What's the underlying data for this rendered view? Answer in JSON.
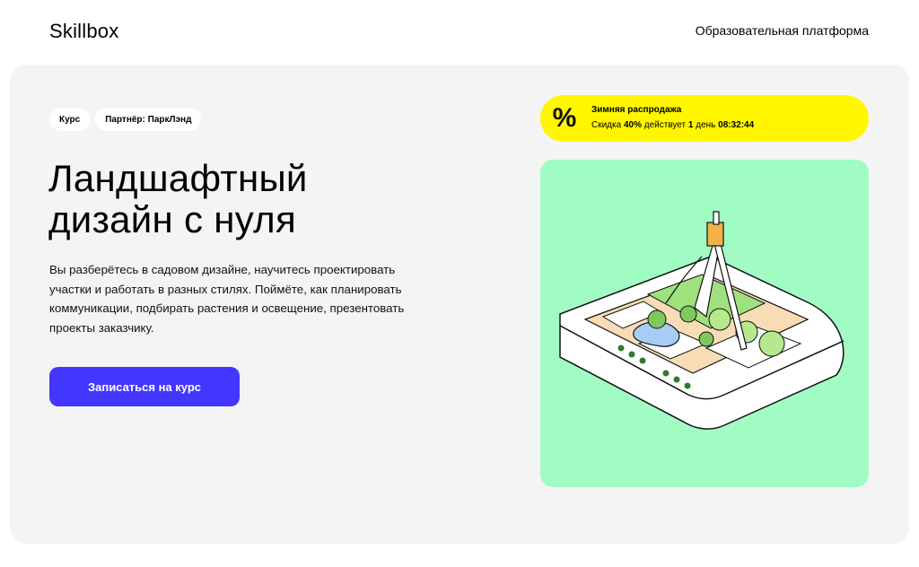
{
  "header": {
    "logo": "Skillbox",
    "platform_label": "Образовательная платформа"
  },
  "hero": {
    "tags": [
      "Курс",
      "Партнёр: ПаркЛэнд"
    ],
    "title_lines": [
      "Ландшафтный",
      "дизайн с нуля"
    ],
    "description_lines": [
      "Вы разберётесь в садовом дизайне, научитесь проектировать",
      "участки и работать в разных стилях. Поймёте, как планировать",
      "коммуникации, подбирать растения и освещение, презентовать",
      "проекты заказчику."
    ],
    "cta_label": "Записаться на курс"
  },
  "promo": {
    "icon": "percent-icon",
    "icon_glyph": "%",
    "title": "Зимняя распродажа",
    "text_prefix": "Скидка ",
    "discount": "40%",
    "text_middle": " действует ",
    "days": "1",
    "text_days_word": " день ",
    "timer": "08:32:44"
  },
  "illustration": {
    "icon": "garden-plan-with-compass-illustration"
  },
  "colors": {
    "accent": "#4236ff",
    "promo_bg": "#fff600",
    "illustration_bg": "#a1fcc4",
    "hero_bg": "#f4f4f4"
  }
}
